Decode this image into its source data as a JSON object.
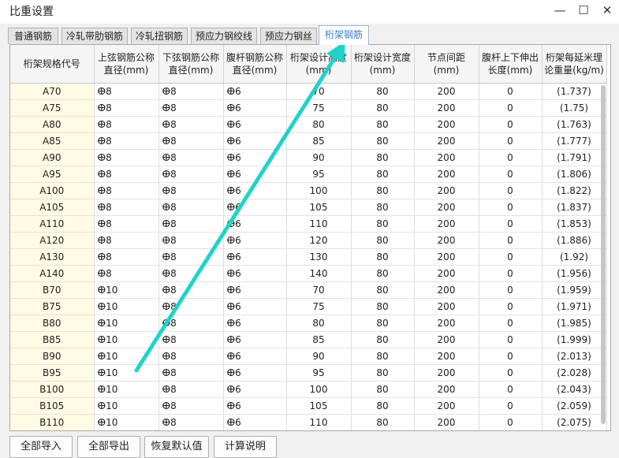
{
  "window": {
    "title": "比重设置"
  },
  "tabs": [
    {
      "label": "普通钢筋"
    },
    {
      "label": "冷轧带肋钢筋"
    },
    {
      "label": "冷轧扭钢筋"
    },
    {
      "label": "预应力钢绞线"
    },
    {
      "label": "预应力钢丝"
    },
    {
      "label": "桁架钢筋"
    }
  ],
  "active_tab": 5,
  "columns": [
    "桁架规格代号",
    "上弦钢筋公称直径(mm)",
    "下弦钢筋公称直径(mm)",
    "腹杆钢筋公称直径(mm)",
    "桁架设计高度(mm)",
    "桁架设计宽度(mm)",
    "节点间距(mm)",
    "腹杆上下伸出长度(mm)",
    "桁架每延米理论重量(kg/m)"
  ],
  "rows": [
    [
      "A70",
      "ⴲ8",
      "ⴲ8",
      "ⴲ6",
      "70",
      "80",
      "200",
      "0",
      "(1.737)"
    ],
    [
      "A75",
      "ⴲ8",
      "ⴲ8",
      "ⴲ6",
      "75",
      "80",
      "200",
      "0",
      "(1.75)"
    ],
    [
      "A80",
      "ⴲ8",
      "ⴲ8",
      "ⴲ6",
      "80",
      "80",
      "200",
      "0",
      "(1.763)"
    ],
    [
      "A85",
      "ⴲ8",
      "ⴲ8",
      "ⴲ6",
      "85",
      "80",
      "200",
      "0",
      "(1.777)"
    ],
    [
      "A90",
      "ⴲ8",
      "ⴲ8",
      "ⴲ6",
      "90",
      "80",
      "200",
      "0",
      "(1.791)"
    ],
    [
      "A95",
      "ⴲ8",
      "ⴲ8",
      "ⴲ6",
      "95",
      "80",
      "200",
      "0",
      "(1.806)"
    ],
    [
      "A100",
      "ⴲ8",
      "ⴲ8",
      "ⴲ6",
      "100",
      "80",
      "200",
      "0",
      "(1.822)"
    ],
    [
      "A105",
      "ⴲ8",
      "ⴲ8",
      "ⴲ6",
      "105",
      "80",
      "200",
      "0",
      "(1.837)"
    ],
    [
      "A110",
      "ⴲ8",
      "ⴲ8",
      "ⴲ6",
      "110",
      "80",
      "200",
      "0",
      "(1.853)"
    ],
    [
      "A120",
      "ⴲ8",
      "ⴲ8",
      "ⴲ6",
      "120",
      "80",
      "200",
      "0",
      "(1.886)"
    ],
    [
      "A130",
      "ⴲ8",
      "ⴲ8",
      "ⴲ6",
      "130",
      "80",
      "200",
      "0",
      "(1.92)"
    ],
    [
      "A140",
      "ⴲ8",
      "ⴲ8",
      "ⴲ6",
      "140",
      "80",
      "200",
      "0",
      "(1.956)"
    ],
    [
      "B70",
      "ⴲ10",
      "ⴲ8",
      "ⴲ6",
      "70",
      "80",
      "200",
      "0",
      "(1.959)"
    ],
    [
      "B75",
      "ⴲ10",
      "ⴲ8",
      "ⴲ6",
      "75",
      "80",
      "200",
      "0",
      "(1.971)"
    ],
    [
      "B80",
      "ⴲ10",
      "ⴲ8",
      "ⴲ6",
      "80",
      "80",
      "200",
      "0",
      "(1.985)"
    ],
    [
      "B85",
      "ⴲ10",
      "ⴲ8",
      "ⴲ6",
      "85",
      "80",
      "200",
      "0",
      "(1.999)"
    ],
    [
      "B90",
      "ⴲ10",
      "ⴲ8",
      "ⴲ6",
      "90",
      "80",
      "200",
      "0",
      "(2.013)"
    ],
    [
      "B95",
      "ⴲ10",
      "ⴲ8",
      "ⴲ6",
      "95",
      "80",
      "200",
      "0",
      "(2.028)"
    ],
    [
      "B100",
      "ⴲ10",
      "ⴲ8",
      "ⴲ6",
      "100",
      "80",
      "200",
      "0",
      "(2.043)"
    ],
    [
      "B105",
      "ⴲ10",
      "ⴲ8",
      "ⴲ6",
      "105",
      "80",
      "200",
      "0",
      "(2.059)"
    ],
    [
      "B110",
      "ⴲ10",
      "ⴲ8",
      "ⴲ6",
      "110",
      "80",
      "200",
      "0",
      "(2.075)"
    ]
  ],
  "buttons": {
    "import_all": "全部导入",
    "export_all": "全部导出",
    "restore_default": "恢复默认值",
    "calc_note": "计算说明"
  },
  "icons": {
    "minimize": "minimize-icon",
    "maximize": "maximize-icon",
    "close": "close-icon",
    "annotation": "arrow-annotation-icon"
  },
  "colors": {
    "accent": "#3a7fc7",
    "code_cell_bg": "#fefae3",
    "annotation_arrow": "#1fd3c9"
  }
}
